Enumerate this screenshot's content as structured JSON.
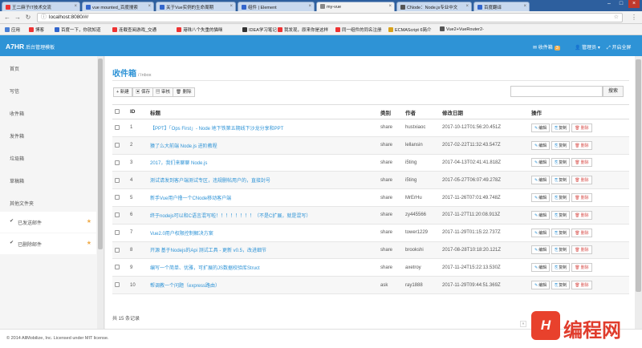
{
  "browser": {
    "tabs": [
      {
        "label": "王二麻子IT技术交流",
        "active": false
      },
      {
        "label": "vue mounted_百度搜索",
        "active": false
      },
      {
        "label": "关于Vue实例的生命周期",
        "active": false
      },
      {
        "label": "组件 | Element",
        "active": false
      },
      {
        "label": "my-vue",
        "active": true
      },
      {
        "label": "CNode：Node.js专业中文",
        "active": false
      },
      {
        "label": "百度翻译",
        "active": false
      }
    ],
    "url": "localhost:8080/#/",
    "bookmarks": [
      "应用",
      "博客",
      "百度一下，你就知道",
      "连载查阅游戏_交通",
      "港珠八个失重的猫咪",
      "IDEA学习笔记",
      "我发现，原来你是这样",
      "同一组件的同名注册",
      "ECMAScript 6简介",
      "Vue2+VueRouter2-"
    ]
  },
  "app": {
    "brand": "A7HR",
    "brand_sub": "后台管理模板",
    "nav_inbox": "收件箱",
    "nav_inbox_badge": "3",
    "nav_user": "管理员",
    "nav_logout": "开启全屏"
  },
  "sidebar": {
    "items": [
      "首页",
      "写信",
      "收件箱",
      "发件箱",
      "垃圾箱",
      "草稿箱",
      "其他文件夹"
    ],
    "subitems": [
      "已发送邮件",
      "已删除邮件"
    ]
  },
  "page": {
    "title": "收件箱",
    "subtitle": "/ Inbox",
    "toolbar": [
      "+ 新建",
      "保存",
      "审核",
      "删除"
    ],
    "search_button": "搜索"
  },
  "table": {
    "headers": [
      "",
      "ID",
      "标题",
      "类别",
      "作者",
      "修改日期",
      "操作"
    ],
    "rows": [
      {
        "id": "1",
        "title": "【PPT】「Ops First」- Node 地下铁第五期线下沙龙分享和PPT",
        "cat": "share",
        "author": "hustxiaoc",
        "date": "2017-10-12T01:56:20.451Z"
      },
      {
        "id": "2",
        "title": "猿了么大前端 Node.js 进阶教程",
        "cat": "share",
        "author": "lellansin",
        "date": "2017-02-22T11:32:43.547Z"
      },
      {
        "id": "3",
        "title": "2017，我们来聊聊 Node.js",
        "cat": "share",
        "author": "i5ting",
        "date": "2017-04-13T02:41:41.818Z"
      },
      {
        "id": "4",
        "title": "测试请发到客户端测试专区，违规删帖用户的，直接封号",
        "cat": "share",
        "author": "i5ting",
        "date": "2017-05-27T06:07:49.278Z"
      },
      {
        "id": "5",
        "title": "新手Vue用户撸一个CNode移动客户端",
        "cat": "share",
        "author": "MrErHu",
        "date": "2017-11-26T07:01:49.748Z"
      },
      {
        "id": "6",
        "title": "终于nodejs可以和C语言混写啦！！！！！！！！（不是C扩展，就是混写）",
        "cat": "share",
        "author": "zy445566",
        "date": "2017-11-27T11:20:08.913Z"
      },
      {
        "id": "7",
        "title": "Vue2.0用户权限控制解决方案",
        "cat": "share",
        "author": "tower1229",
        "date": "2017-11-29T01:15:22.737Z"
      },
      {
        "id": "8",
        "title": "开源 基于Nodejs的Api 测试工具 - 更新 v0.5，改进细节",
        "cat": "share",
        "author": "brookshi",
        "date": "2017-08-28T10:18:20.121Z"
      },
      {
        "id": "9",
        "title": "编写一个简单、优雅，可扩展的JS数据校验库Struct",
        "cat": "share",
        "author": "axetroy",
        "date": "2017-11-24T15:22:13.530Z"
      },
      {
        "id": "10",
        "title": "帮调教一个问题（express路由）",
        "cat": "ask",
        "author": "ray1888",
        "date": "2017-11-29T09:44:51.369Z"
      }
    ],
    "actions": [
      "编辑",
      "复制",
      "删除"
    ]
  },
  "total_text": "共 15 条记录",
  "footer": "© 2014 AllMobilize, Inc. Licensed under MIT license.",
  "watermark": "编程网",
  "colors": {
    "accent": "#2e93d6",
    "danger": "#d9534f",
    "warn": "#f0ad4e"
  }
}
